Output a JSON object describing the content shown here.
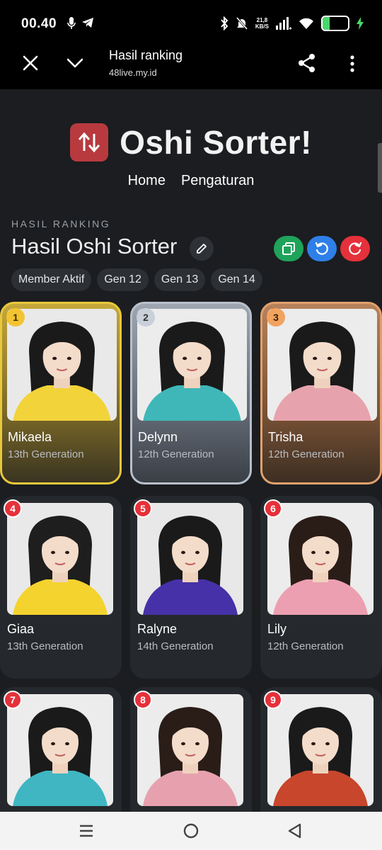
{
  "status_bar": {
    "time": "00.40",
    "speed_value": "21,8",
    "speed_unit": "KB/S",
    "battery": "27",
    "battery_level": 0.27
  },
  "browser": {
    "title": "Hasil ranking",
    "url": "48live.my.id"
  },
  "app": {
    "brand_title": "Oshi Sorter!",
    "nav": [
      "Home",
      "Pengaturan"
    ]
  },
  "result": {
    "section_label": "HASIL RANKING",
    "title": "Hasil Oshi Sorter",
    "filters": [
      "Member Aktif",
      "Gen 12",
      "Gen 13",
      "Gen 14"
    ]
  },
  "ranking": [
    {
      "rank": "1",
      "name": "Mikaela",
      "generation": "13th Generation",
      "shirt": "#f2d33a",
      "bg": "#e9e9e9",
      "hair": "#1a1a1a"
    },
    {
      "rank": "2",
      "name": "Delynn",
      "generation": "12th Generation",
      "shirt": "#3fb7b8",
      "bg": "#ececec",
      "hair": "#1a1a1a"
    },
    {
      "rank": "3",
      "name": "Trisha",
      "generation": "12th Generation",
      "shirt": "#e7a3ad",
      "bg": "#ececec",
      "hair": "#1a1a1a"
    },
    {
      "rank": "4",
      "name": "Giaa",
      "generation": "13th Generation",
      "shirt": "#f4d32e",
      "bg": "#e9e9e9",
      "hair": "#1e1e1e"
    },
    {
      "rank": "5",
      "name": "Ralyne",
      "generation": "14th Generation",
      "shirt": "#4631a8",
      "bg": "#e8e8e8",
      "hair": "#1a1a1a"
    },
    {
      "rank": "6",
      "name": "Lily",
      "generation": "12th Generation",
      "shirt": "#ec9fb0",
      "bg": "#ececec",
      "hair": "#2a1d18"
    },
    {
      "rank": "7",
      "name": "",
      "generation": "",
      "shirt": "#3fb6c2",
      "bg": "#ececec",
      "hair": "#1a1a1a"
    },
    {
      "rank": "8",
      "name": "",
      "generation": "",
      "shirt": "#e7a1ae",
      "bg": "#ececec",
      "hair": "#2a1d18"
    },
    {
      "rank": "9",
      "name": "",
      "generation": "",
      "shirt": "#c7462c",
      "bg": "#ececec",
      "hair": "#1a1a1a"
    }
  ],
  "icons": {
    "status_left": [
      "microphone-icon",
      "telegram-icon"
    ],
    "status_right": [
      "bluetooth-icon",
      "mute-icon",
      "signal-icon",
      "wifi-icon",
      "battery-icon",
      "charging-icon"
    ],
    "browser": [
      "close-icon",
      "chevron-down-icon",
      "share-icon",
      "more-vert-icon"
    ],
    "actions": [
      "copy-icon",
      "undo-icon",
      "redo-icon",
      "edit-pencil-icon"
    ],
    "nav_bar": [
      "recents-icon",
      "home-icon",
      "back-icon"
    ]
  },
  "colors": {
    "background": "#1b1d20",
    "card": "#25282c",
    "gold": "#e9c83b",
    "silver": "#b8c0ca",
    "bronze": "#e0a06c",
    "rank_badge": "#e5313a",
    "copy_button": "#1fa35a",
    "undo_button": "#2f7fe8",
    "redo_button": "#e4313b",
    "logo": "#b83a3f"
  }
}
